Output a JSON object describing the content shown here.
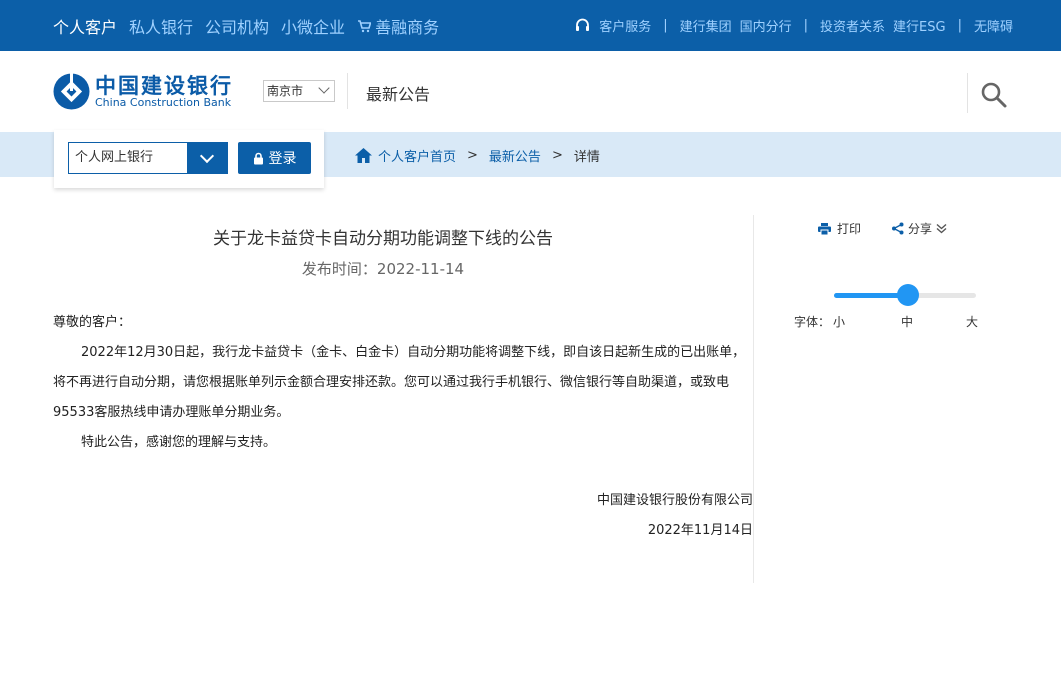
{
  "topnav": {
    "left": [
      "个人客户",
      "私人银行",
      "公司机构",
      "小微企业",
      "善融商务"
    ],
    "right": [
      "客户服务",
      "建行集团",
      "国内分行",
      "投资者关系",
      "建行ESG",
      "无障碍"
    ],
    "sep": "|"
  },
  "header": {
    "logo_cn": "中国建设银行",
    "logo_en": "China Construction Bank",
    "city": "南京市",
    "page_name": "最新公告"
  },
  "login": {
    "select_label": "个人网上银行",
    "button": "登录"
  },
  "breadcrumb": {
    "home": "个人客户首页",
    "arrow": ">",
    "section": "最新公告",
    "current": "详情"
  },
  "article": {
    "title": "关于龙卡益贷卡自动分期功能调整下线的公告",
    "pubdate": "发布时间：2022-11-14",
    "greeting": "尊敬的客户：",
    "p1": "2022年12月30日起，我行龙卡益贷卡（金卡、白金卡）自动分期功能将调整下线，即自该日起新生成的已出账单，将不再进行自动分期，请您根据账单列示金额合理安排还款。您可以通过我行手机银行、微信银行等自助渠道，或致电95533客服热线申请办理账单分期业务。",
    "p2": "特此公告，感谢您的理解与支持。",
    "signer": "中国建设银行股份有限公司",
    "sign_date": "2022年11月14日"
  },
  "tools": {
    "print": "打印",
    "share": "分享",
    "font_label": "字体：",
    "font_small": "小",
    "font_mid": "中",
    "font_large": "大",
    "font_level": 0.5
  },
  "colors": {
    "brand": "#0c5fa8",
    "accent": "#2196f3",
    "band": "#d9e9f7"
  }
}
